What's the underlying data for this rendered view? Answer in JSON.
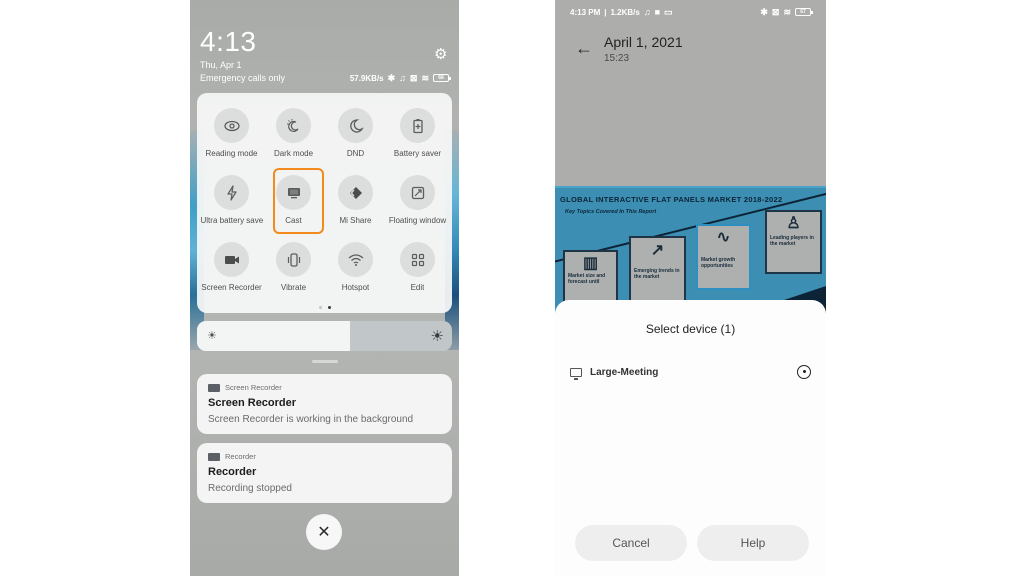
{
  "left_phone": {
    "clock": "4:13",
    "date": "Thu, Apr 1",
    "carrier_status": "Emergency calls only",
    "network_speed": "57.9KB/s",
    "battery_level": "68",
    "quick_settings": [
      {
        "label": "Reading mode",
        "icon": "eye-icon",
        "glyph": "◉"
      },
      {
        "label": "Dark mode",
        "icon": "dark-mode-icon",
        "glyph": "☼"
      },
      {
        "label": "DND",
        "icon": "moon-icon",
        "glyph": "☾"
      },
      {
        "label": "Battery saver",
        "icon": "battery-plus-icon",
        "glyph": "▯"
      },
      {
        "label": "Ultra battery saver",
        "icon": "lightning-icon",
        "glyph": "ϟ"
      },
      {
        "label": "Cast",
        "icon": "monitor-icon",
        "glyph": "▬",
        "highlighted": true
      },
      {
        "label": "Mi Share",
        "icon": "mi-share-icon",
        "glyph": "◆"
      },
      {
        "label": "Floating window",
        "icon": "floating-window-icon",
        "glyph": "⧄"
      },
      {
        "label": "Screen Recorder",
        "icon": "video-camera-icon",
        "glyph": "■"
      },
      {
        "label": "Vibrate",
        "icon": "vibrate-icon",
        "glyph": "▯"
      },
      {
        "label": "Hotspot",
        "icon": "hotspot-icon",
        "glyph": "≋"
      },
      {
        "label": "Edit",
        "icon": "grid-icon",
        "glyph": "⊞"
      }
    ],
    "page_indicator": {
      "pages": 2,
      "active": 2
    },
    "brightness_percent": 60,
    "notifications": [
      {
        "app": "Screen Recorder",
        "title": "Screen Recorder",
        "body": "Screen Recorder is working in the background"
      },
      {
        "app": "Recorder",
        "title": "Recorder",
        "body": "Recording stopped"
      }
    ],
    "close_glyph": "✕"
  },
  "right_phone": {
    "status_time": "4:13 PM",
    "network_speed": "1.2KB/s",
    "battery_level": "67",
    "header": {
      "title": "April 1, 2021",
      "subtitle": "15:23"
    },
    "infographic": {
      "title": "GLOBAL INTERACTIVE FLAT PANELS MARKET 2018-2022",
      "subtitle": "Key Topics Covered In This Report",
      "boxes": [
        {
          "label": "Market size and forecast until",
          "glyph": "▥"
        },
        {
          "label": "Emerging trends in the market",
          "glyph": "↗"
        },
        {
          "label": "Market growth opportunities",
          "glyph": "∿"
        },
        {
          "label": "Leading players in the market",
          "glyph": "♙"
        }
      ]
    },
    "dialog": {
      "title": "Select device (1)",
      "devices": [
        {
          "name": "Large-Meeting",
          "status": "connecting"
        }
      ],
      "cancel_label": "Cancel",
      "help_label": "Help"
    }
  },
  "colors": {
    "highlight": "#f28a1d",
    "infographic_blue": "#3c8fb3",
    "infographic_navy": "#0d2438"
  }
}
